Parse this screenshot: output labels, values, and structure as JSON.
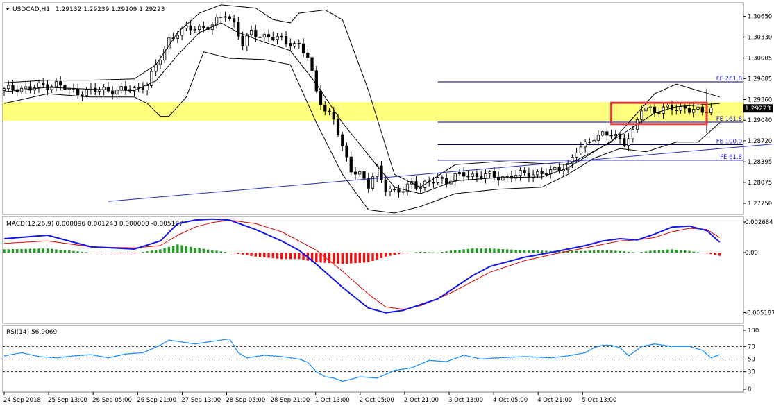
{
  "header": {
    "symbol": "USDCAD,H1",
    "ohlc": "1.29132 1.29239 1.29109 1.29223",
    "menu_icon": "triangle-down-icon"
  },
  "chart_data": [
    {
      "type": "candlestick",
      "title": "USDCAD,H1",
      "ylim": [
        1.276,
        1.3084
      ],
      "y_ticks": [
        "1.30650",
        "1.30330",
        "1.30005",
        "1.29685",
        "1.29360",
        "1.29040",
        "1.28720",
        "1.28395",
        "1.28075",
        "1.27750"
      ],
      "x_ticks": [
        "24 Sep 2018",
        "25 Sep 13:00",
        "26 Sep 05:00",
        "26 Sep 21:00",
        "27 Sep 13:00",
        "28 Sep 05:00",
        "28 Sep 21:00",
        "1 Oct 13:00",
        "2 Oct 05:00",
        "2 Oct 21:00",
        "3 Oct 13:00",
        "4 Oct 05:00",
        "4 Oct 21:00",
        "5 Oct 13:00"
      ],
      "current_price": "1.29223",
      "support_zone": [
        1.2903,
        1.2932
      ],
      "fibonacci_levels": [
        {
          "label": "FE 261.8",
          "value": 1.29635
        },
        {
          "label": "FE 161.8",
          "value": 1.2901
        },
        {
          "label": "FE 100.0",
          "value": 1.2866
        },
        {
          "label": "FE 61.8",
          "value": 1.2842
        }
      ],
      "trendline": [
        {
          "x": 24,
          "y": 1.2778
        },
        {
          "x": 179,
          "y": 1.2868
        }
      ],
      "highlight_box": {
        "x_range": [
          140,
          162
        ],
        "y_range": [
          1.2898,
          1.2931
        ]
      },
      "bollinger": {
        "upper": [
          [
            0,
            1.2962
          ],
          [
            10,
            1.2966
          ],
          [
            20,
            1.2966
          ],
          [
            30,
            1.2968
          ],
          [
            35,
            1.299
          ],
          [
            40,
            1.304
          ],
          [
            45,
            1.307
          ],
          [
            50,
            1.3083
          ],
          [
            58,
            1.3078
          ],
          [
            62,
            1.306
          ],
          [
            66,
            1.3055
          ],
          [
            68,
            1.307
          ],
          [
            74,
            1.3075
          ],
          [
            78,
            1.306
          ],
          [
            84,
            1.295
          ],
          [
            90,
            1.282
          ],
          [
            96,
            1.28
          ],
          [
            104,
            1.2835
          ],
          [
            114,
            1.284
          ],
          [
            130,
            1.2835
          ],
          [
            140,
            1.287
          ],
          [
            150,
            1.2945
          ],
          [
            155,
            1.296
          ],
          [
            160,
            1.295
          ],
          [
            165,
            1.294
          ]
        ],
        "middle": [
          [
            0,
            1.2948
          ],
          [
            10,
            1.2955
          ],
          [
            20,
            1.2952
          ],
          [
            30,
            1.295
          ],
          [
            35,
            1.2965
          ],
          [
            40,
            1.3005
          ],
          [
            45,
            1.304
          ],
          [
            50,
            1.3055
          ],
          [
            54,
            1.304
          ],
          [
            60,
            1.3025
          ],
          [
            66,
            1.3012
          ],
          [
            72,
            1.296
          ],
          [
            78,
            1.29
          ],
          [
            84,
            1.285
          ],
          [
            90,
            1.28
          ],
          [
            96,
            1.279
          ],
          [
            104,
            1.281
          ],
          [
            114,
            1.2815
          ],
          [
            124,
            1.2816
          ],
          [
            130,
            1.283
          ],
          [
            136,
            1.2855
          ],
          [
            142,
            1.288
          ],
          [
            150,
            1.2915
          ],
          [
            155,
            1.2925
          ],
          [
            165,
            1.293
          ]
        ],
        "lower": [
          [
            0,
            1.293
          ],
          [
            10,
            1.2945
          ],
          [
            20,
            1.294
          ],
          [
            30,
            1.294
          ],
          [
            33,
            1.293
          ],
          [
            36,
            1.291
          ],
          [
            38,
            1.291
          ],
          [
            42,
            1.294
          ],
          [
            46,
            1.301
          ],
          [
            52,
            1.3
          ],
          [
            60,
            1.2998
          ],
          [
            66,
            1.299
          ],
          [
            72,
            1.29
          ],
          [
            78,
            1.282
          ],
          [
            84,
            1.2765
          ],
          [
            90,
            1.276
          ],
          [
            96,
            1.277
          ],
          [
            104,
            1.279
          ],
          [
            114,
            1.2797
          ],
          [
            124,
            1.28
          ],
          [
            130,
            1.282
          ],
          [
            136,
            1.2845
          ],
          [
            142,
            1.286
          ],
          [
            148,
            1.2855
          ],
          [
            155,
            1.287
          ],
          [
            160,
            1.287
          ],
          [
            165,
            1.29
          ]
        ]
      },
      "close": [
        [
          0,
          1.295
        ],
        [
          3,
          1.2955
        ],
        [
          6,
          1.2952
        ],
        [
          9,
          1.2958
        ],
        [
          12,
          1.296
        ],
        [
          15,
          1.295
        ],
        [
          18,
          1.2948
        ],
        [
          21,
          1.295
        ],
        [
          24,
          1.2952
        ],
        [
          27,
          1.295
        ],
        [
          30,
          1.2952
        ],
        [
          33,
          1.296
        ],
        [
          36,
          1.3
        ],
        [
          38,
          1.303
        ],
        [
          40,
          1.304
        ],
        [
          44,
          1.3048
        ],
        [
          48,
          1.305
        ],
        [
          51,
          1.307
        ],
        [
          53,
          1.3055
        ],
        [
          55,
          1.302
        ],
        [
          57,
          1.304
        ],
        [
          60,
          1.3035
        ],
        [
          63,
          1.303
        ],
        [
          66,
          1.3025
        ],
        [
          68,
          1.302
        ],
        [
          70,
          1.3
        ],
        [
          72,
          1.295
        ],
        [
          74,
          1.292
        ],
        [
          76,
          1.2905
        ],
        [
          78,
          1.286
        ],
        [
          80,
          1.283
        ],
        [
          82,
          1.282
        ],
        [
          84,
          1.28
        ],
        [
          86,
          1.283
        ],
        [
          88,
          1.28
        ],
        [
          90,
          1.279
        ],
        [
          92,
          1.2795
        ],
        [
          94,
          1.281
        ],
        [
          96,
          1.28
        ],
        [
          98,
          1.2805
        ],
        [
          100,
          1.2815
        ],
        [
          102,
          1.281
        ],
        [
          106,
          1.282
        ],
        [
          110,
          1.2818
        ],
        [
          114,
          1.2816
        ],
        [
          118,
          1.2818
        ],
        [
          122,
          1.2822
        ],
        [
          126,
          1.2822
        ],
        [
          128,
          1.283
        ],
        [
          130,
          1.2835
        ],
        [
          132,
          1.2855
        ],
        [
          134,
          1.2865
        ],
        [
          136,
          1.288
        ],
        [
          138,
          1.2882
        ],
        [
          140,
          1.288
        ],
        [
          142,
          1.2875
        ],
        [
          143,
          1.2872
        ],
        [
          145,
          1.2885
        ],
        [
          147,
          1.292
        ],
        [
          149,
          1.2922
        ],
        [
          151,
          1.292
        ],
        [
          153,
          1.2922
        ],
        [
          155,
          1.292
        ],
        [
          157,
          1.2925
        ],
        [
          159,
          1.292
        ],
        [
          161,
          1.2915
        ],
        [
          163,
          1.2922
        ]
      ],
      "points_in_plot": 170
    },
    {
      "type": "line",
      "title": "MACD(12,26,9) 0.000896 0.001243 0.000000 -0.005187",
      "ylim": [
        -0.006,
        0.003
      ],
      "y_ticks": [
        "0.002684",
        "0.00",
        "-0.005187"
      ],
      "macd": [
        [
          0,
          0.0012
        ],
        [
          10,
          0.0015
        ],
        [
          20,
          0.0005
        ],
        [
          30,
          0.0003
        ],
        [
          36,
          0.001
        ],
        [
          40,
          0.0025
        ],
        [
          44,
          0.0028
        ],
        [
          48,
          0.0029
        ],
        [
          52,
          0.0028
        ],
        [
          58,
          0.002
        ],
        [
          64,
          0.001
        ],
        [
          68,
          0.0002
        ],
        [
          72,
          -0.001
        ],
        [
          78,
          -0.003
        ],
        [
          84,
          -0.0048
        ],
        [
          88,
          -0.0052
        ],
        [
          92,
          -0.005
        ],
        [
          96,
          -0.0045
        ],
        [
          100,
          -0.004
        ],
        [
          104,
          -0.003
        ],
        [
          108,
          -0.002
        ],
        [
          112,
          -0.0012
        ],
        [
          120,
          -0.0004
        ],
        [
          126,
          0.0
        ],
        [
          130,
          0.0003
        ],
        [
          134,
          0.0006
        ],
        [
          138,
          0.001
        ],
        [
          142,
          0.0012
        ],
        [
          146,
          0.0011
        ],
        [
          150,
          0.0016
        ],
        [
          154,
          0.0022
        ],
        [
          158,
          0.0023
        ],
        [
          162,
          0.0019
        ],
        [
          165,
          0.0009
        ]
      ],
      "signal": [
        [
          0,
          0.0008
        ],
        [
          10,
          0.001
        ],
        [
          20,
          0.0005
        ],
        [
          30,
          0.0004
        ],
        [
          36,
          0.0006
        ],
        [
          40,
          0.0015
        ],
        [
          44,
          0.0022
        ],
        [
          48,
          0.0026
        ],
        [
          52,
          0.0028
        ],
        [
          58,
          0.0025
        ],
        [
          64,
          0.0018
        ],
        [
          68,
          0.001
        ],
        [
          72,
          0.0002
        ],
        [
          78,
          -0.0016
        ],
        [
          84,
          -0.0036
        ],
        [
          88,
          -0.0047
        ],
        [
          92,
          -0.0049
        ],
        [
          96,
          -0.0046
        ],
        [
          100,
          -0.004
        ],
        [
          104,
          -0.0033
        ],
        [
          108,
          -0.0025
        ],
        [
          112,
          -0.0017
        ],
        [
          120,
          -0.0007
        ],
        [
          126,
          -0.0002
        ],
        [
          130,
          0.0001
        ],
        [
          134,
          0.0004
        ],
        [
          138,
          0.0007
        ],
        [
          142,
          0.001
        ],
        [
          146,
          0.0011
        ],
        [
          150,
          0.0013
        ],
        [
          154,
          0.0018
        ],
        [
          158,
          0.0021
        ],
        [
          162,
          0.002
        ],
        [
          165,
          0.0013
        ]
      ]
    },
    {
      "type": "line",
      "title": "RSI(14) 56.9069",
      "ylim": [
        0,
        100
      ],
      "y_ticks": [
        "70",
        "50",
        "30"
      ],
      "y_ticks_extra": [
        "100",
        "0"
      ],
      "levels": [
        70,
        50,
        30
      ],
      "rsi": [
        [
          0,
          55
        ],
        [
          4,
          60
        ],
        [
          8,
          54
        ],
        [
          12,
          52
        ],
        [
          16,
          55
        ],
        [
          20,
          57
        ],
        [
          24,
          52
        ],
        [
          28,
          58
        ],
        [
          32,
          60
        ],
        [
          36,
          72
        ],
        [
          38,
          80
        ],
        [
          40,
          78
        ],
        [
          44,
          74
        ],
        [
          48,
          78
        ],
        [
          52,
          82
        ],
        [
          54,
          60
        ],
        [
          56,
          52
        ],
        [
          60,
          56
        ],
        [
          64,
          54
        ],
        [
          68,
          50
        ],
        [
          70,
          45
        ],
        [
          72,
          30
        ],
        [
          74,
          22
        ],
        [
          76,
          20
        ],
        [
          78,
          15
        ],
        [
          80,
          18
        ],
        [
          82,
          22
        ],
        [
          86,
          20
        ],
        [
          90,
          32
        ],
        [
          94,
          36
        ],
        [
          98,
          48
        ],
        [
          102,
          46
        ],
        [
          106,
          56
        ],
        [
          110,
          50
        ],
        [
          114,
          52
        ],
        [
          120,
          54
        ],
        [
          126,
          52
        ],
        [
          130,
          55
        ],
        [
          134,
          60
        ],
        [
          136,
          68
        ],
        [
          138,
          72
        ],
        [
          140,
          72
        ],
        [
          142,
          68
        ],
        [
          144,
          55
        ],
        [
          147,
          70
        ],
        [
          150,
          74
        ],
        [
          154,
          70
        ],
        [
          158,
          70
        ],
        [
          161,
          64
        ],
        [
          163,
          52
        ],
        [
          165,
          57
        ]
      ]
    }
  ],
  "colors": {
    "bull_candle": "#ffffff",
    "bear_candle": "#000000",
    "support_zone": "#ffff66",
    "highlight_box": "#e33b3b",
    "trendline": "#2b2bb8",
    "fib_line": "#00006e",
    "fib_label": "#1111ee",
    "macd_line": "#1515e8",
    "signal_line": "#dd0000",
    "hist_positive": "#1e9e1e",
    "hist_negative": "#ee1111",
    "rsi_line": "#1e90ff",
    "price_tag_bg": "#000000",
    "price_tag_text": "#ffffff"
  }
}
